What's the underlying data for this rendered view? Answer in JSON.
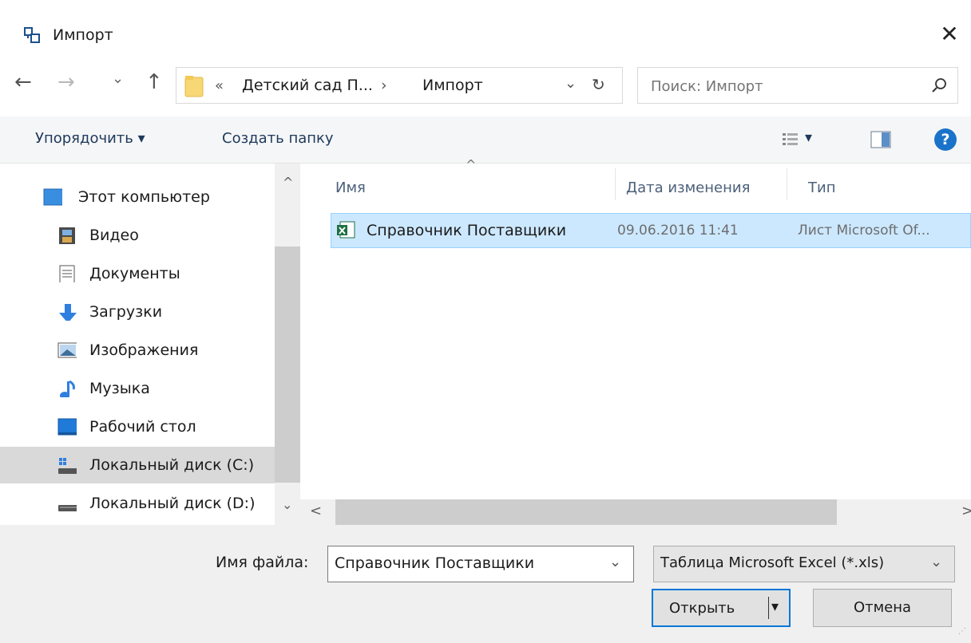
{
  "window": {
    "title": "Импорт",
    "close_glyph": "✕"
  },
  "navigation": {
    "back_glyph": "←",
    "forward_glyph": "→",
    "recent_glyph": "⌄",
    "up_glyph": "↑",
    "breadcrumb_overflow": "«",
    "breadcrumb_parent": "Детский сад П...",
    "breadcrumb_separator": "›",
    "breadcrumb_current": "Импорт",
    "dropdown_glyph": "⌄",
    "refresh_glyph": "↻"
  },
  "search": {
    "placeholder": "Поиск: Импорт"
  },
  "toolbar": {
    "organize_label": "Упорядочить ▾",
    "new_folder_label": "Создать папку",
    "view_dropdown_glyph": "▾",
    "help_glyph": "?"
  },
  "sidebar": {
    "items": [
      {
        "label": "Этот компьютер",
        "icon": "computer-icon"
      },
      {
        "label": "Видео",
        "icon": "video-icon"
      },
      {
        "label": "Документы",
        "icon": "documents-icon"
      },
      {
        "label": "Загрузки",
        "icon": "downloads-icon"
      },
      {
        "label": "Изображения",
        "icon": "pictures-icon"
      },
      {
        "label": "Музыка",
        "icon": "music-icon"
      },
      {
        "label": "Рабочий стол",
        "icon": "desktop-icon"
      },
      {
        "label": "Локальный диск (C:)",
        "icon": "drive-c-icon",
        "selected": true
      },
      {
        "label": "Локальный диск (D:)",
        "icon": "drive-d-icon"
      }
    ]
  },
  "file_list": {
    "columns": [
      "Имя",
      "Дата изменения",
      "Тип"
    ],
    "sort_glyph": "^",
    "rows": [
      {
        "name": "Справочник Поставщики",
        "date": "09.06.2016 11:41",
        "type": "Лист Microsoft Of...",
        "icon": "excel-file-icon"
      }
    ]
  },
  "scrollbars": {
    "up_glyph": "^",
    "down_glyph": "⌄",
    "left_glyph": "<",
    "right_glyph": ">"
  },
  "footer": {
    "filename_label": "Имя файла:",
    "filename_value": "Справочник Поставщики",
    "filter_value": "Таблица Microsoft Excel (*.xls)",
    "dropdown_glyph": "⌄",
    "open_label": "Открыть",
    "split_glyph": "▾",
    "cancel_label": "Отмена"
  },
  "colors": {
    "selection": "#cce8ff",
    "selection_border": "#99d1ff",
    "link_text": "#1e395b",
    "help_blue": "#1a73c9",
    "excel_green": "#1d7044",
    "folder_yellow": "#f8d775"
  }
}
